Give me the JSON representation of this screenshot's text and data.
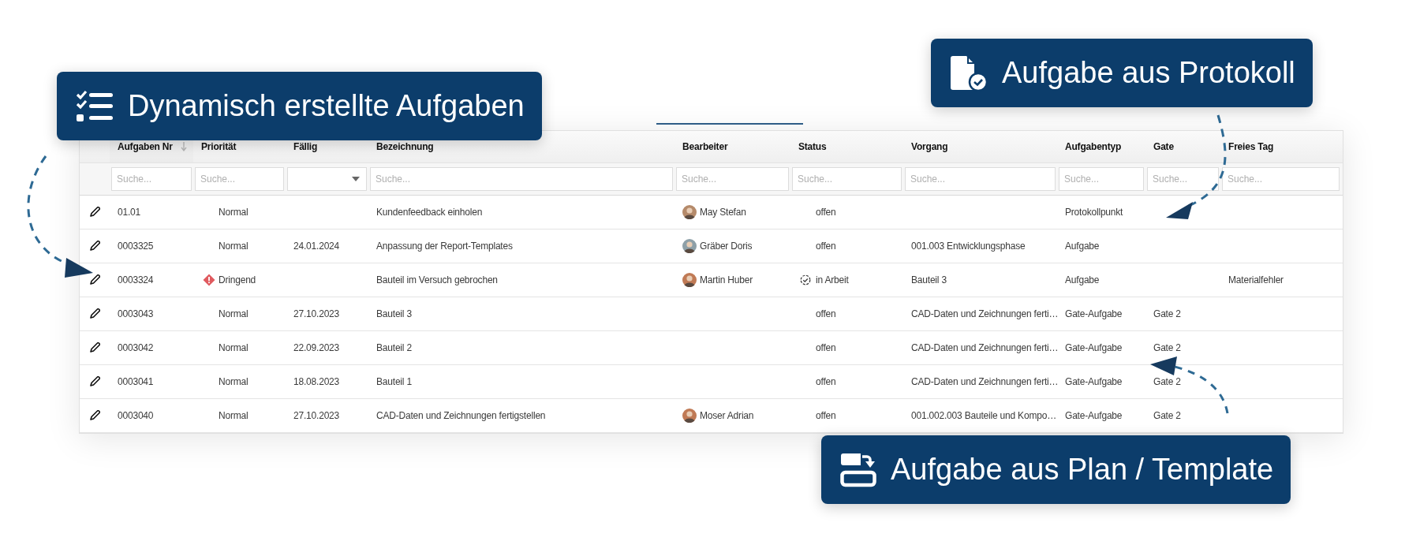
{
  "callouts": [
    {
      "kind": "checklist",
      "text": "Dynamisch erstellte Aufgaben"
    },
    {
      "kind": "document-check",
      "text": "Aufgabe aus Protokoll"
    },
    {
      "kind": "template",
      "text": "Aufgabe aus Plan / Template"
    }
  ],
  "table": {
    "columns": [
      {
        "label": "Aufgaben Nr",
        "sorted": true
      },
      {
        "label": "Priorität",
        "sorted": false
      },
      {
        "label": "Fällig",
        "sorted": false
      },
      {
        "label": "Bezeichnung",
        "sorted": false
      },
      {
        "label": "Bearbeiter",
        "sorted": false
      },
      {
        "label": "Status",
        "sorted": false
      },
      {
        "label": "Vorgang",
        "sorted": false
      },
      {
        "label": "Aufgabentyp",
        "sorted": false
      },
      {
        "label": "Gate",
        "sorted": false
      },
      {
        "label": "Freies Tag",
        "sorted": false
      }
    ],
    "filters": [
      {
        "kind": "text",
        "placeholder": "Suche..."
      },
      {
        "kind": "text",
        "placeholder": "Suche..."
      },
      {
        "kind": "dropdown"
      },
      {
        "kind": "text",
        "placeholder": "Suche..."
      },
      {
        "kind": "text",
        "placeholder": "Suche..."
      },
      {
        "kind": "text",
        "placeholder": "Suche..."
      },
      {
        "kind": "text",
        "placeholder": "Suche..."
      },
      {
        "kind": "text",
        "placeholder": "Suche..."
      },
      {
        "kind": "text",
        "placeholder": "Suche..."
      },
      {
        "kind": "text",
        "placeholder": "Suche..."
      }
    ],
    "rows": [
      {
        "nr": "01.01",
        "priority": {
          "label": "Normal",
          "urgent": false
        },
        "title": "Kundenfeedback einholen",
        "assignee": "May Stefan",
        "status": {
          "label": "offen",
          "in_progress": false
        },
        "type": "Protokollpunkt"
      },
      {
        "nr": "0003325",
        "priority": {
          "label": "Normal",
          "urgent": false
        },
        "due": "24.01.2024",
        "title": "Anpassung der Report-Templates",
        "assignee": "Gräber Doris",
        "status": {
          "label": "offen",
          "in_progress": false
        },
        "process": "001.003 Entwicklungsphase",
        "type": "Aufgabe"
      },
      {
        "nr": "0003324",
        "priority": {
          "label": "Dringend",
          "urgent": true
        },
        "title": "Bauteil im Versuch gebrochen",
        "assignee": "Martin Huber",
        "status": {
          "label": "in Arbeit",
          "in_progress": true
        },
        "process": "Bauteil 3",
        "type": "Aufgabe",
        "tag": "Materialfehler"
      },
      {
        "nr": "0003043",
        "priority": {
          "label": "Normal",
          "urgent": false
        },
        "due": "27.10.2023",
        "title": "Bauteil 3",
        "status": {
          "label": "offen",
          "in_progress": false
        },
        "process": "CAD-Daten und Zeichnungen ferti…",
        "type": "Gate-Aufgabe",
        "gate": "Gate 2"
      },
      {
        "nr": "0003042",
        "priority": {
          "label": "Normal",
          "urgent": false
        },
        "due": "22.09.2023",
        "title": "Bauteil 2",
        "status": {
          "label": "offen",
          "in_progress": false
        },
        "process": "CAD-Daten und Zeichnungen ferti…",
        "type": "Gate-Aufgabe",
        "gate": "Gate 2"
      },
      {
        "nr": "0003041",
        "priority": {
          "label": "Normal",
          "urgent": false
        },
        "due": "18.08.2023",
        "title": "Bauteil 1",
        "status": {
          "label": "offen",
          "in_progress": false
        },
        "process": "CAD-Daten und Zeichnungen ferti…",
        "type": "Gate-Aufgabe",
        "gate": "Gate 2"
      },
      {
        "nr": "0003040",
        "priority": {
          "label": "Normal",
          "urgent": false
        },
        "due": "27.10.2023",
        "title": "CAD-Daten und Zeichnungen fertigstellen",
        "assignee": "Moser Adrian",
        "status": {
          "label": "offen",
          "in_progress": false
        },
        "process": "001.002.003 Bauteile und Kompo…",
        "type": "Gate-Aufgabe",
        "gate": "Gate 2"
      }
    ]
  }
}
